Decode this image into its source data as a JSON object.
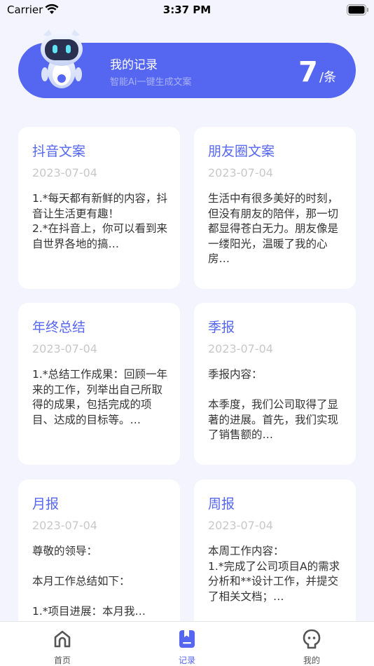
{
  "status_bar": {
    "carrier": "Carrier",
    "time": "3:37 PM"
  },
  "header": {
    "title": "我的记录",
    "subtitle": "智能Ai一键生成文案",
    "count": "7",
    "unit": "/条"
  },
  "records": [
    {
      "title": "抖音文案",
      "date": "2023-07-04",
      "preview": "1.*每天都有新鲜的内容，抖音让生活更有趣！\n2.*在抖音上，你可以看到来自世界各地的搞…"
    },
    {
      "title": "朋友圈文案",
      "date": "2023-07-04",
      "preview": "生活中有很多美好的时刻，但没有朋友的陪伴，那一切都显得苍白无力。朋友像是一缕阳光，温暖了我的心房…"
    },
    {
      "title": "年终总结",
      "date": "2023-07-04",
      "preview": "1.*总结工作成果：回顾一年来的工作，列举出自己所取得的成果，包括完成的项目、达成的目标等。…"
    },
    {
      "title": "季报",
      "date": "2023-07-04",
      "preview": "季报内容：\n\n本季度，我们公司取得了显著的进展。首先，我们实现了销售额的…"
    },
    {
      "title": "月报",
      "date": "2023-07-04",
      "preview": "尊敬的领导：\n\n本月工作总结如下：\n\n1.*项目进展：本月我…"
    },
    {
      "title": "周报",
      "date": "2023-07-04",
      "preview": "本周工作内容：\n1.*完成了公司项目A的需求分析和**设计工作，并提交了相关文档；…"
    }
  ],
  "tabs": [
    {
      "label": "首页",
      "icon": "home-icon",
      "active": false
    },
    {
      "label": "记录",
      "icon": "record-icon",
      "active": true
    },
    {
      "label": "我的",
      "icon": "profile-icon",
      "active": false
    }
  ],
  "colors": {
    "accent": "#5566f1",
    "background": "#f3f4fd",
    "date_gray": "#c8c8c8"
  }
}
